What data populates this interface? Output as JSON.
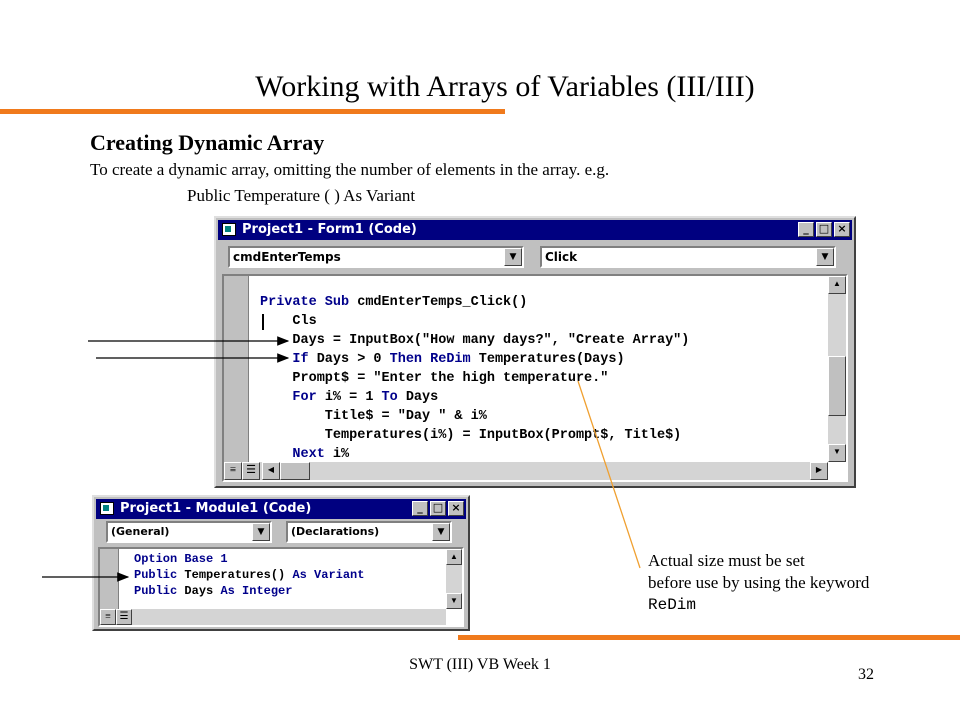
{
  "slide": {
    "title": "Working with Arrays of Variables (III/III)",
    "subtitle": "Creating Dynamic Array",
    "description": "To create a dynamic array, omitting the number of elements in the array. e.g.",
    "example": "Public Temperature ( ) As Variant",
    "note_line1": "Actual size must be set",
    "note_line2": "before use by using the keyword",
    "note_keyword": "ReDim",
    "footer": "SWT (III) VB Week 1",
    "page_number": "32",
    "accent_color": "#f07a1c"
  },
  "form_window": {
    "title": "Project1 - Form1 (Code)",
    "object_combo": "cmdEnterTemps",
    "procedure_combo": "Click",
    "code_lines": [
      [
        {
          "t": "Private Sub",
          "k": true
        },
        {
          "t": " cmdEnterTemps_Click()"
        }
      ],
      [
        {
          "t": "    Cls"
        }
      ],
      [
        {
          "t": "    Days = InputBox(\"How many days?\", \"Create Array\")"
        }
      ],
      [
        {
          "t": "    "
        },
        {
          "t": "If",
          "k": true
        },
        {
          "t": " Days > 0 "
        },
        {
          "t": "Then ReDim",
          "k": true
        },
        {
          "t": " Temperatures(Days)"
        }
      ],
      [
        {
          "t": "    Prompt$ = \"Enter the high temperature.\""
        }
      ],
      [
        {
          "t": "    "
        },
        {
          "t": "For",
          "k": true
        },
        {
          "t": " i% = 1 "
        },
        {
          "t": "To",
          "k": true
        },
        {
          "t": " Days"
        }
      ],
      [
        {
          "t": "        Title$ = \"Day \" & i%"
        }
      ],
      [
        {
          "t": "        Temperatures(i%) = InputBox(Prompt$, Title$)"
        }
      ],
      [
        {
          "t": "    "
        },
        {
          "t": "Next",
          "k": true
        },
        {
          "t": " i%"
        }
      ]
    ]
  },
  "module_window": {
    "title": "Project1 - Module1 (Code)",
    "object_combo": "(General)",
    "procedure_combo": "(Declarations)",
    "code_lines": [
      [
        {
          "t": "Option Base 1",
          "k": true
        }
      ],
      [
        {
          "t": "Public",
          "k": true
        },
        {
          "t": " Temperatures() "
        },
        {
          "t": "As Variant",
          "k": true
        }
      ],
      [
        {
          "t": "Public",
          "k": true
        },
        {
          "t": " Days "
        },
        {
          "t": "As Integer",
          "k": true
        }
      ]
    ]
  },
  "icons": {
    "window_system_icon": "vb-code-window-icon",
    "minimize": "minimize-icon",
    "maximize": "maximize-icon",
    "close": "close-icon"
  }
}
